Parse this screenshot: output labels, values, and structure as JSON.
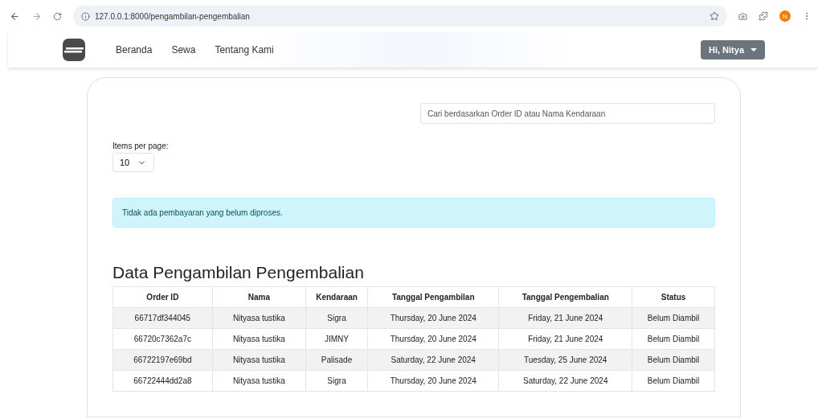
{
  "browser": {
    "url": "127.0.0.1:8000/pengambilan-pengembalian",
    "profile_initial": "N"
  },
  "navbar": {
    "links": [
      {
        "label": "Beranda"
      },
      {
        "label": "Sewa"
      },
      {
        "label": "Tentang Kami"
      }
    ],
    "user_menu": "Hi, Nitya"
  },
  "search": {
    "placeholder": "Cari berdasarkan Order ID atau Nama Kendaraan"
  },
  "items_per_page": {
    "label": "Items per page:",
    "value": "10"
  },
  "alert": "Tidak ada pembayaran yang belum diproses.",
  "heading": "Data Pengambilan Pengembalian",
  "table": {
    "columns": [
      "Order ID",
      "Nama",
      "Kendaraan",
      "Tanggal Pengambilan",
      "Tanggal Pengembalian",
      "Status"
    ],
    "rows": [
      [
        "66717df344045",
        "Nityasa tustika",
        "Sigra",
        "Thursday, 20 June 2024",
        "Friday, 21 June 2024",
        "Belum Diambil"
      ],
      [
        "66720c7362a7c",
        "Nityasa tustika",
        "JIMNY",
        "Thursday, 20 June 2024",
        "Friday, 21 June 2024",
        "Belum Diambil"
      ],
      [
        "66722197e69bd",
        "Nityasa tustika",
        "Palisade",
        "Saturday, 22 June 2024",
        "Tuesday, 25 June 2024",
        "Belum Diambil"
      ],
      [
        "66722444dd2a8",
        "Nityasa tustika",
        "Sigra",
        "Thursday, 20 June 2024",
        "Saturday, 22 June 2024",
        "Belum Diambil"
      ]
    ]
  }
}
